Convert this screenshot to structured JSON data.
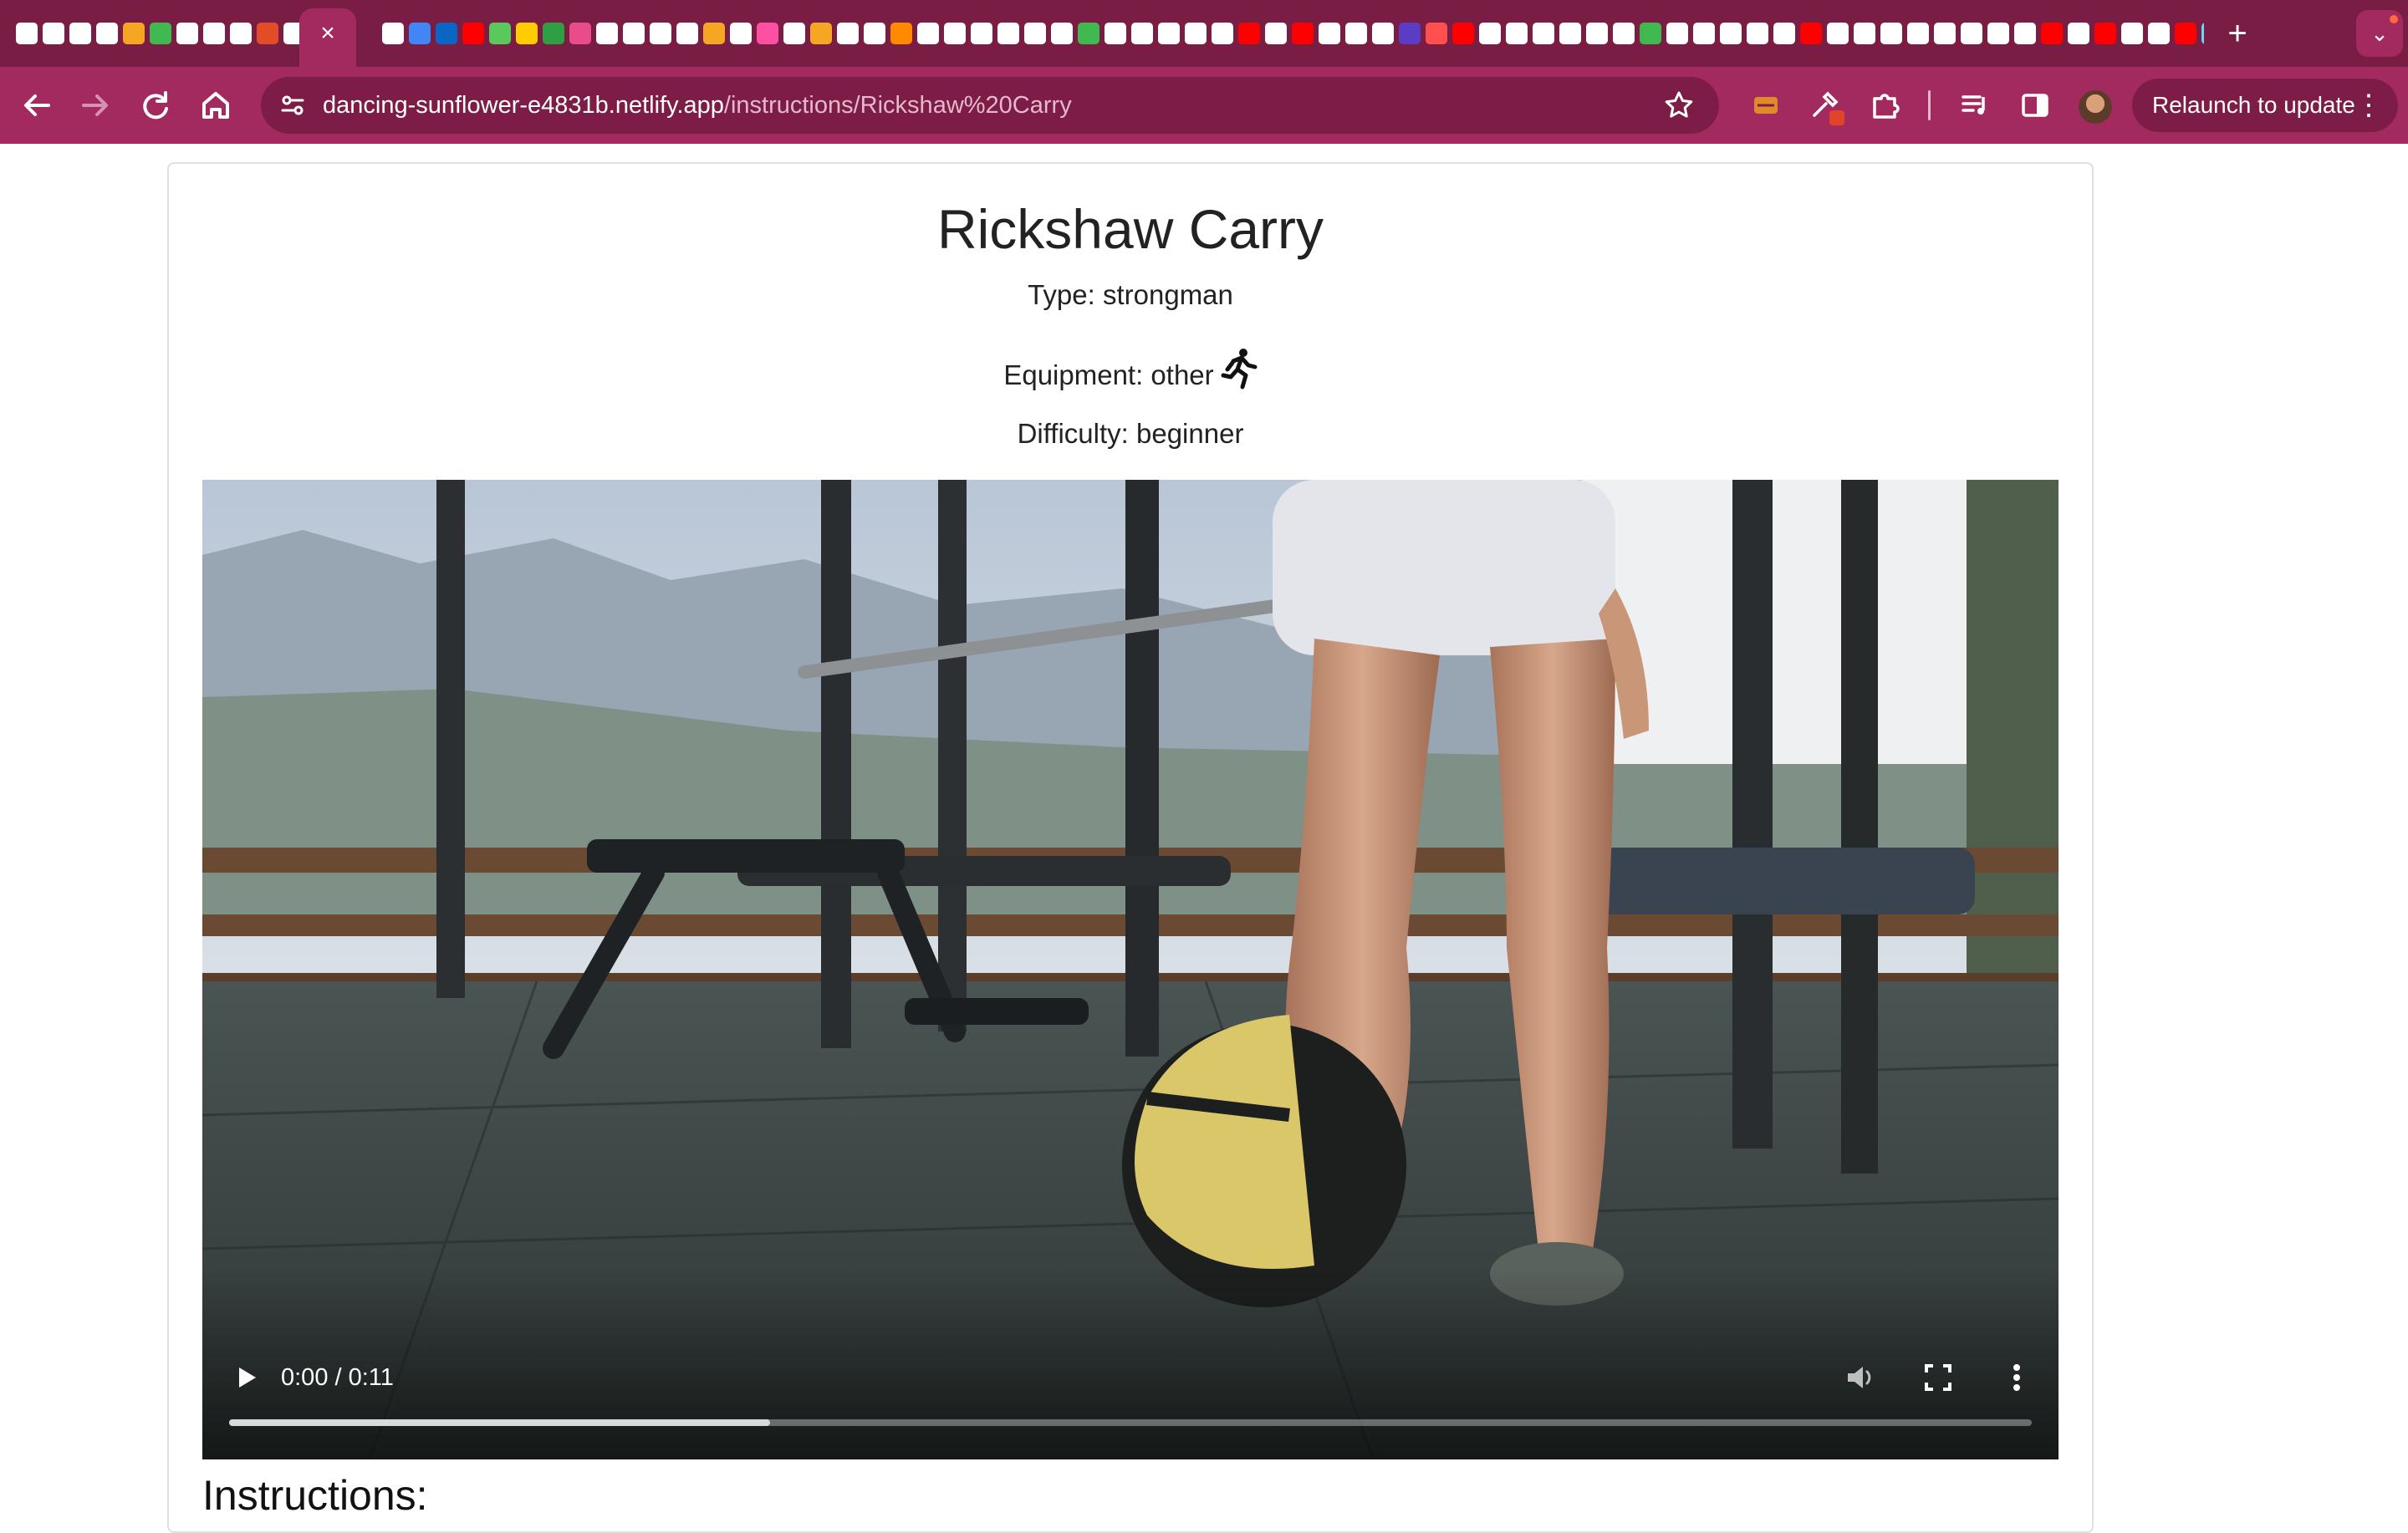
{
  "browser": {
    "active_tab_close": "×",
    "new_tab": "+",
    "tab_search_icon": "⌄",
    "url_host": "dancing-sunflower-e4831b.netlify.app",
    "url_path": "/instructions/Rickshaw%20Carry",
    "relaunch_label": "Relaunch to update",
    "tab_favicon_colors": [
      "#ffffff",
      "#ffffff",
      "#ffffff",
      "#ffffff",
      "#f5a623",
      "#3fb950",
      "#ffffff",
      "#ffffff",
      "#ffffff",
      "#e34c26",
      "#ffffff",
      "#ffffff",
      "#4285f4",
      "#0a66c2",
      "#ff0000",
      "#5ac85a",
      "#ffcc00",
      "#2ea043",
      "#e84d8a",
      "#ffffff",
      "#ffffff",
      "#ffffff",
      "#ffffff",
      "#f5a623",
      "#ffffff",
      "#ff4fa3",
      "#ffffff",
      "#f5a623",
      "#ffffff",
      "#ffffff",
      "#ff8a00",
      "#ffffff",
      "#ffffff",
      "#ffffff",
      "#ffffff",
      "#ffffff",
      "#ffffff",
      "#3fb950",
      "#ffffff",
      "#ffffff",
      "#ffffff",
      "#ffffff",
      "#ffffff",
      "#ff0000",
      "#ffffff",
      "#ff0000",
      "#ffffff",
      "#ffffff",
      "#ffffff",
      "#5b3cc4",
      "#ff4f4f",
      "#ff0000",
      "#ffffff",
      "#ffffff",
      "#ffffff",
      "#ffffff",
      "#ffffff",
      "#ffffff",
      "#3fb950",
      "#ffffff",
      "#ffffff",
      "#ffffff",
      "#ffffff",
      "#ffffff",
      "#ff0000",
      "#ffffff",
      "#ffffff",
      "#ffffff",
      "#ffffff",
      "#ffffff",
      "#ffffff",
      "#ffffff",
      "#ffffff",
      "#ff0000",
      "#ffffff",
      "#ff0000",
      "#ffffff",
      "#ffffff",
      "#ff0000",
      "#61dafb",
      "#ffffff"
    ]
  },
  "page": {
    "title": "Rickshaw Carry",
    "type_line": "Type: strongman",
    "equipment_line": "Equipment: other",
    "difficulty_line": "Difficulty: beginner",
    "instructions_heading": "Instructions:"
  },
  "video": {
    "time": "0:00 / 0:11",
    "buffered_fraction": 0.3
  }
}
